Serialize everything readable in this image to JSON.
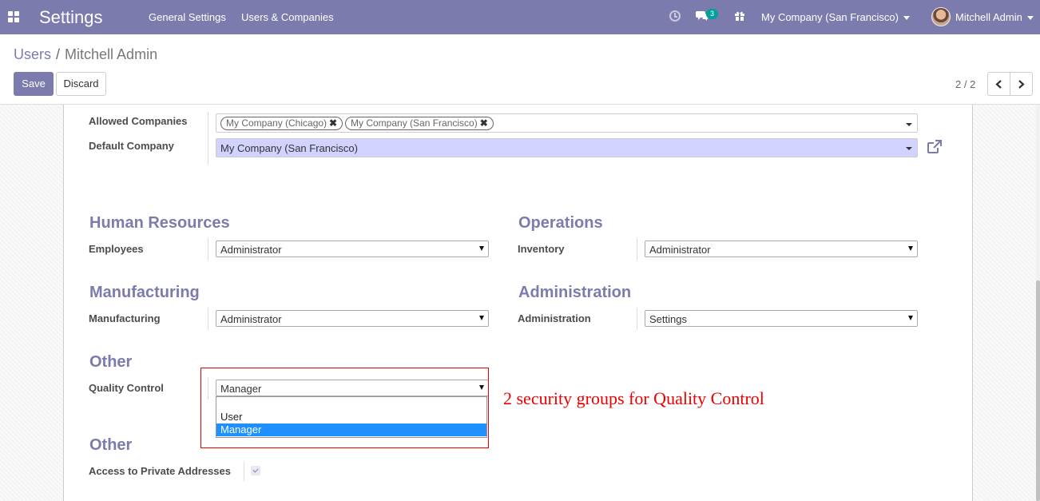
{
  "navbar": {
    "app_title": "Settings",
    "menu": [
      "General Settings",
      "Users & Companies"
    ],
    "chat_count": "3",
    "company": "My Company (San Francisco)",
    "user": "Mitchell Admin"
  },
  "control_panel": {
    "breadcrumb": [
      "Users",
      "Mitchell Admin"
    ],
    "save_label": "Save",
    "discard_label": "Discard",
    "pager": "2 / 2"
  },
  "form": {
    "allowed_companies": {
      "label": "Allowed Companies",
      "tags": [
        "My Company (Chicago)",
        "My Company (San Francisco)"
      ]
    },
    "default_company": {
      "label": "Default Company",
      "value": "My Company (San Francisco)"
    },
    "groups": [
      {
        "title": "Human Resources",
        "field": "Employees",
        "value": "Administrator"
      },
      {
        "title": "Operations",
        "field": "Inventory",
        "value": "Administrator"
      },
      {
        "title": "Manufacturing",
        "field": "Manufacturing",
        "value": "Administrator"
      },
      {
        "title": "Administration",
        "field": "Administration",
        "value": "Settings"
      },
      {
        "title": "Other",
        "field": "Quality Control",
        "value": "Manager"
      },
      {
        "title": "Other",
        "field": "Access to Private Addresses",
        "checked": true
      }
    ],
    "quality_control_options": [
      "",
      "User",
      "Manager"
    ],
    "quality_control_selected": "Manager"
  },
  "annotation": {
    "text": "2 security groups for Quality Control",
    "color": "#e00000"
  },
  "colors": {
    "brand": "#7c7bad",
    "badge": "#00a09d",
    "required_field": "#d2d2ff",
    "option_highlight": "#1e90ff"
  }
}
